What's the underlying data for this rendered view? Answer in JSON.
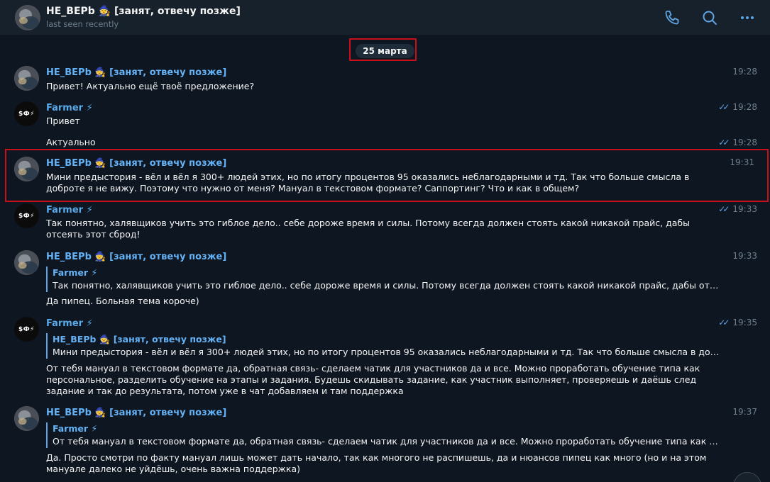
{
  "header": {
    "name": "HE_BEPb 🧙 [занят, отвечу позже]",
    "status": "last seen recently",
    "call_icon": "phone-icon",
    "search_icon": "search-icon",
    "more_icon": "more-dots-icon"
  },
  "date_label": "25 марта",
  "avatars": {
    "farmer_text": "$Ф⚡"
  },
  "messages": [
    {
      "sender": "HE_BEPb 🧙 [занят, отвечу позже]",
      "time": "19:28",
      "text": "Привет! Актуально ещё твоё предложение?"
    },
    {
      "sender": "Farmer ⚡",
      "time": "19:28",
      "read": true,
      "text": "Привет"
    },
    {
      "time": "19:28",
      "read": true,
      "text": "Актуально"
    },
    {
      "sender": "HE_BEPb 🧙 [занят, отвечу позже]",
      "time": "19:31",
      "text": "Мини предыстория - вёл и вёл я 300+ людей этих, но по итогу процентов 95 оказались неблагодарными и тд. Так что больше смысла в доброте я не вижу. Поэтому что нужно от меня? Мануал в текстовом формате? Саппортинг? Что и как в общем?"
    },
    {
      "sender": "Farmer ⚡",
      "time": "19:33",
      "read": true,
      "text": "Так понятно, халявщиков учить это гиблое дело.. себе дороже время и силы. Потому всегда должен стоять какой никакой прайс, дабы отсеять этот сброд!"
    },
    {
      "sender": "HE_BEPb 🧙 [занят, отвечу позже]",
      "time": "19:33",
      "reply_name": "Farmer ⚡",
      "reply_text": "Так понятно, халявщиков учить это гиблое дело.. себе дороже время и силы. Потому всегда должен стоять какой никакой прайс, дабы отсеять э…",
      "text": "Да пипец. Больная тема короче)"
    },
    {
      "sender": "Farmer ⚡",
      "time": "19:35",
      "read": true,
      "reply_name": "HE_BEPb 🧙 [занят, отвечу позже]",
      "reply_text": "Мини предыстория - вёл и вёл я 300+ людей этих, но по итогу процентов 95 оказались неблагодарными и тд. Так что больше смысла в доброте…",
      "text": "От тебя мануал в текстовом формате да, обратная связь- сделаем чатик для участников да и все. Можно проработать обучение типа как персональное, разделить обучение на этапы и задания. Будешь скидывать задание, как участник выполняет, проверяешь и даёшь след задание и так до результата, потом уже в чат добавляем и там поддержка"
    },
    {
      "sender": "HE_BEPb 🧙 [занят, отвечу позже]",
      "time": "19:37",
      "reply_name": "Farmer ⚡",
      "reply_text": "От тебя мануал в текстовом формате да, обратная связь- сделаем чатик для участников да и все. Можно проработать обучение типа как персон…",
      "text": "Да. Просто смотри по факту мануал лишь может дать начало, так как многого не распишешь, да и нюансов пипец как много (но и на этом мануале далеко не уйдёшь, очень важна поддержка)"
    }
  ]
}
